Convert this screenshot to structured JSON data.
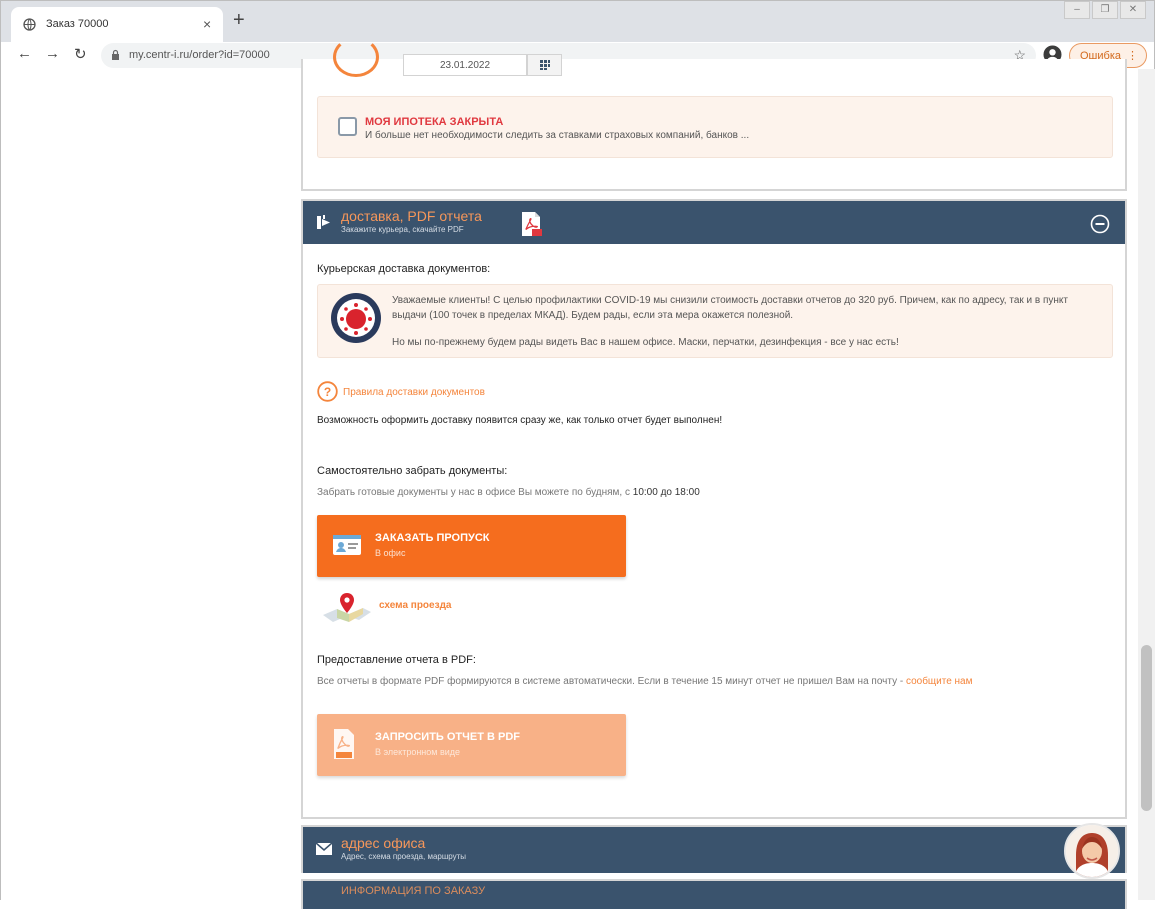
{
  "browser": {
    "tab_title": "Заказ 70000",
    "url": "my.centr-i.ru/order?id=70000",
    "error_label": "Ошибка",
    "new_tab": "+",
    "tab_close": "×"
  },
  "top_block": {
    "date_value": "23.01.2022",
    "mortgage_title": "МОЯ ИПОТЕКА ЗАКРЫТА",
    "mortgage_sub": "И больше нет необходимости следить за ставками страховых компаний, банков ..."
  },
  "delivery": {
    "title": "доставка, PDF отчета",
    "subtitle": "Закажите курьера, скачайте PDF",
    "courier_heading": "Курьерская доставка документов:",
    "courier_text": "Уважаемые клиенты! С целью профилактики COVID-19 мы снизили стоимость доставки отчетов до 320 руб. Причем, как по адресу, так и в пункт выдачи (100 точек в пределах МКАД). Будем рады, если эта мера окажется полезной.",
    "courier_text2": "Но мы по-прежнему будем рады видеть Вас в нашем офисе. Маски, перчатки, дезинфекция - все у нас есть!",
    "rules_link": "Правила доставки документов",
    "notice": "Возможность оформить доставку появится сразу же, как только отчет будет выполнен!",
    "pickup_heading": "Самостоятельно забрать документы:",
    "pickup_desc": "Забрать готовые документы у нас в офисе Вы можете по будням, с",
    "pickup_hours": "10:00 до 18:00",
    "pass_button": "ЗАКАЗАТЬ ПРОПУСК",
    "pass_sub": "В офис",
    "map_link": "схема проезда",
    "pdf_heading": "Предоставление отчета в PDF:",
    "pdf_desc": "Все отчеты в формате PDF формируются в системе автоматически. Если в течение 15 минут отчет не пришел Вам на почту -",
    "pdf_contact": "сообщите нам",
    "pdf_button": "ЗАПРОСИТЬ ОТЧЕТ В PDF",
    "pdf_sub": "В электронном виде"
  },
  "office": {
    "title": "адрес офиса",
    "subtitle": "Адрес, схема проезда, маршруты"
  },
  "next_section": {
    "title": "ИНФОРМАЦИЯ ПО ЗАКАЗУ"
  },
  "colors": {
    "header_bg": "#3a536d",
    "accent_orange": "#f56d1e",
    "accent_light": "#f8b187",
    "link_orange": "#f4853c",
    "alert_red": "#e0383f"
  }
}
